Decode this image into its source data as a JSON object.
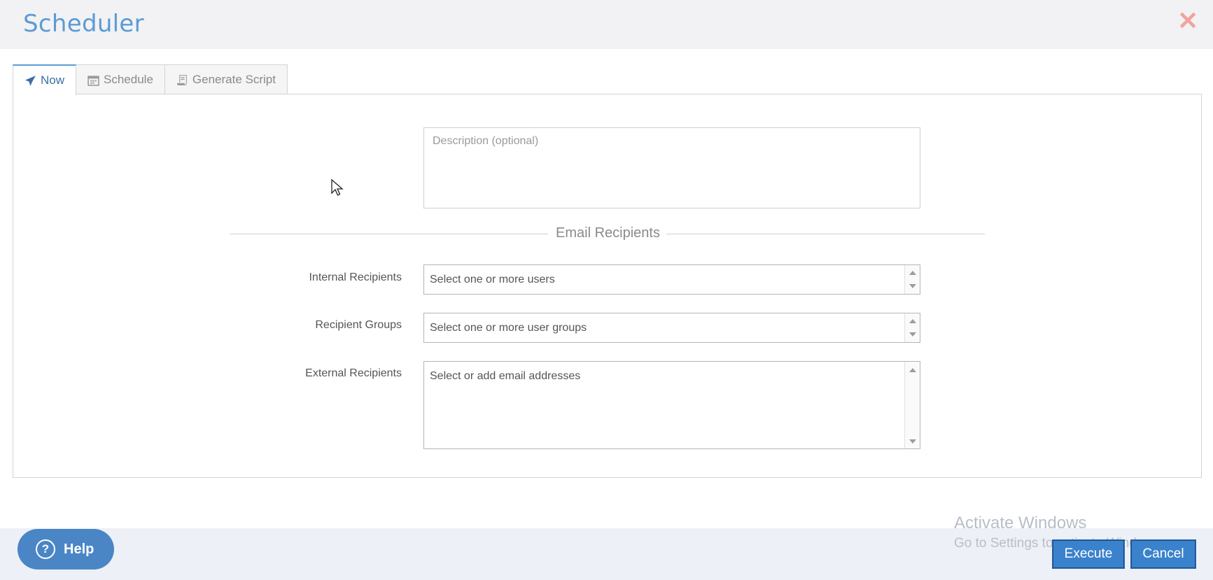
{
  "header": {
    "title": "Scheduler",
    "close_label": "✕"
  },
  "tabs": [
    {
      "label": "Now",
      "icon": "paper-plane-icon",
      "active": true
    },
    {
      "label": "Schedule",
      "icon": "calendar-icon",
      "active": false
    },
    {
      "label": "Generate Script",
      "icon": "script-icon",
      "active": false
    }
  ],
  "form": {
    "description_placeholder": "Description (optional)",
    "section_title": "Email Recipients",
    "internal": {
      "label": "Internal Recipients",
      "placeholder": "Select one or more users"
    },
    "groups": {
      "label": "Recipient Groups",
      "placeholder": "Select one or more user groups"
    },
    "external": {
      "label": "External Recipients",
      "placeholder": "Select or add email addresses"
    }
  },
  "footer": {
    "help_label": "Help",
    "execute_label": "Execute",
    "cancel_label": "Cancel"
  },
  "watermark": {
    "line1": "Activate Windows",
    "line2": "Go to Settings to activate Windows."
  },
  "colors": {
    "accent": "#5b9bd5",
    "button": "#3a82cc",
    "close": "#f0a59b"
  }
}
